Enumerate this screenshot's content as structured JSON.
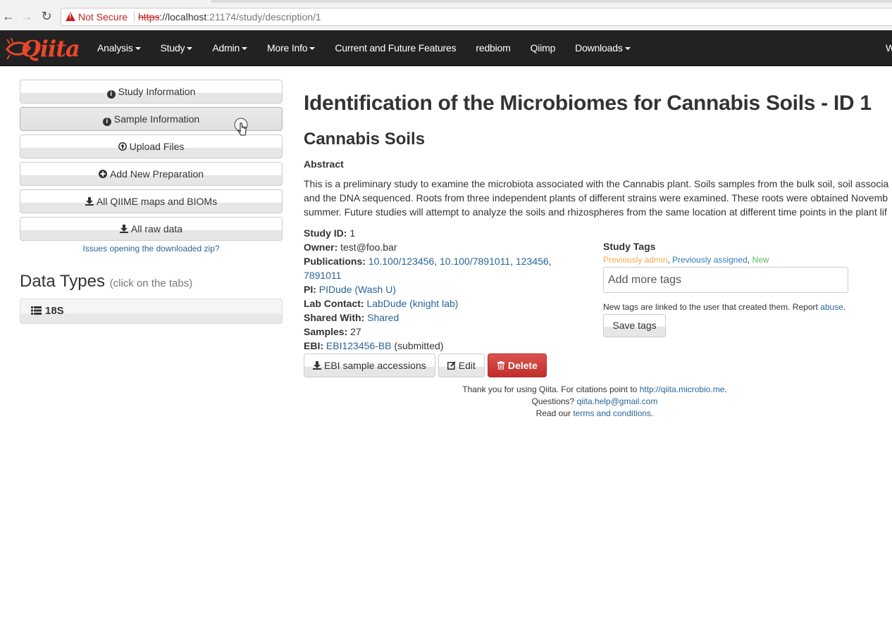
{
  "browser": {
    "security_label": "Not Secure",
    "url_protocol": "https",
    "url_host": "://localhost",
    "url_path": ":21174/study/description/1"
  },
  "navbar": {
    "logo_text": "Qiita",
    "items": [
      {
        "label": "Analysis",
        "dropdown": true
      },
      {
        "label": "Study",
        "dropdown": true
      },
      {
        "label": "Admin",
        "dropdown": true
      },
      {
        "label": "More Info",
        "dropdown": true
      },
      {
        "label": "Current and Future Features",
        "dropdown": false
      },
      {
        "label": "redbiom",
        "dropdown": false
      },
      {
        "label": "Qiimp",
        "dropdown": false
      },
      {
        "label": "Downloads",
        "dropdown": true
      }
    ],
    "cutoff_text": "W"
  },
  "sidebar": {
    "buttons": [
      {
        "label": "Study Information",
        "icon": "info-circle-icon"
      },
      {
        "label": "Sample Information",
        "icon": "info-circle-icon"
      },
      {
        "label": "Upload Files",
        "icon": "upload-circle-icon"
      },
      {
        "label": "Add New Preparation",
        "icon": "plus-circle-icon"
      },
      {
        "label": "All QIIME maps and BIOMs",
        "icon": "download-icon"
      },
      {
        "label": "All raw data",
        "icon": "download-icon"
      }
    ],
    "issues_link": "Issues opening the downloaded zip?",
    "data_types_title": "Data Types",
    "data_types_hint": "(click on the tabs)",
    "data_type_tab": "18S"
  },
  "main": {
    "title": "Identification of the Microbiomes for Cannabis Soils - ID 1",
    "subtitle": "Cannabis Soils",
    "abstract_heading": "Abstract",
    "abstract_lines": [
      "This is a preliminary study to examine the microbiota associated with the Cannabis plant. Soils samples from the bulk soil, soil associa",
      "and the DNA sequenced. Roots from three independent plants of different strains were examined. These roots were obtained Novemb",
      "summer. Future studies will attempt to analyze the soils and rhizospheres from the same location at different time points in the plant lif"
    ],
    "info": {
      "study_id_label": "Study ID:",
      "study_id": "1",
      "owner_label": "Owner:",
      "owner": "test@foo.bar",
      "publications_label": "Publications:",
      "publications": [
        "10.100/123456",
        "10.100/7891011",
        "123456",
        "7891011"
      ],
      "pi_label": "PI:",
      "pi": "PIDude (Wash U)",
      "lab_contact_label": "Lab Contact:",
      "lab_contact": "LabDude (knight lab)",
      "shared_with_label": "Shared With:",
      "shared_with": "Shared",
      "samples_label": "Samples:",
      "samples": "27",
      "ebi_label": "EBI:",
      "ebi": "EBI123456-BB",
      "ebi_status": "(submitted)"
    },
    "actions": {
      "ebi_accessions": "EBI sample accessions",
      "edit": "Edit",
      "delete": "Delete"
    },
    "tags": {
      "heading": "Study Tags",
      "legend_admin": "Previously admin",
      "legend_assigned": "Previously assigned",
      "legend_new": "New",
      "input_placeholder": "Add more tags",
      "note": "New tags are linked to the user that created them. Report",
      "abuse_link": "abuse",
      "save_label": "Save tags"
    }
  },
  "footer": {
    "line1": "Thank you for using Qiita. For citations point to",
    "line1_link": "http://qiita.microbio.me",
    "line2": "Questions?",
    "line2_link": "qiita.help@gmail.com",
    "line3": "Read our",
    "line3_link": "terms and conditions"
  },
  "colors": {
    "navbar_bg": "#222222",
    "logo": "#e9472a",
    "link": "#2a6496",
    "danger": "#d9534f",
    "not_secure": "#c5221f"
  }
}
